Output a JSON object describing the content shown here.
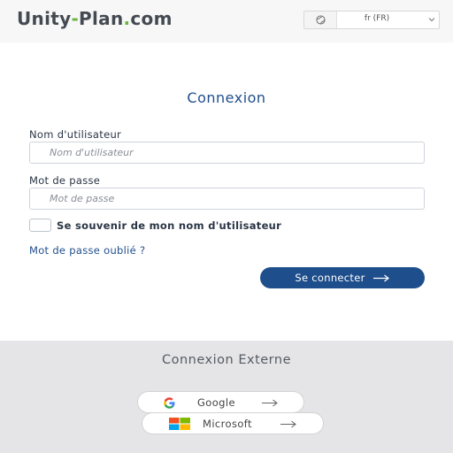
{
  "header": {
    "logo_part1": "Unity",
    "logo_dash": "-",
    "logo_part2": "Plan",
    "logo_dot": ".",
    "logo_part3": "com",
    "language": {
      "selected": "fr (FR)",
      "icon": "globe-icon"
    }
  },
  "login": {
    "title": "Connexion",
    "username_label": "Nom d'utilisateur",
    "username_placeholder": "Nom d'utilisateur",
    "username_value": "",
    "password_label": "Mot de passe",
    "password_placeholder": "Mot de passe",
    "password_value": "",
    "remember_label": "Se souvenir de mon nom d'utilisateur",
    "remember_checked": false,
    "forgot_label": "Mot de passe oublié ?",
    "submit_label": "Se connecter",
    "submit_icon": "arrow-right-icon"
  },
  "external": {
    "title": "Connexion Externe",
    "google_label": "Google",
    "microsoft_label": "Microsoft"
  },
  "colors": {
    "primary": "#1f4e8c",
    "logo_accent": "#6db33f",
    "header_bg": "#f7f7f7",
    "external_bg": "#e5e5e7"
  }
}
